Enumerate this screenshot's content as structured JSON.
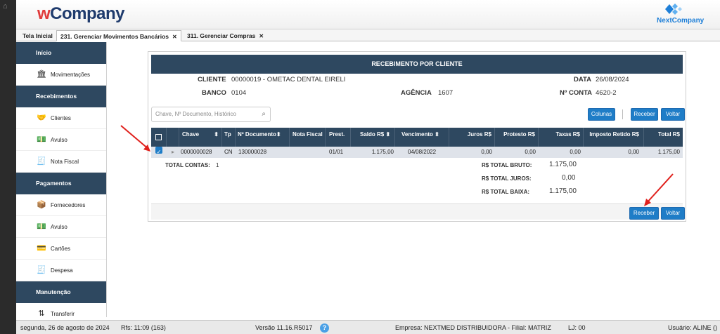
{
  "header": {
    "brand_w": "w",
    "brand_rest": "Company",
    "partner_logo_text": "NextCompany"
  },
  "tabs": [
    {
      "label": "Tela Inicial"
    },
    {
      "label": "231. Gerenciar Movimentos Bancários",
      "close": "✕"
    },
    {
      "label": "311. Gerenciar Compras",
      "close": "✕"
    }
  ],
  "sidebar": {
    "sections": [
      {
        "title": "Início",
        "items": [
          {
            "label": "Movimentações",
            "icon": "bank-icon"
          }
        ]
      },
      {
        "title": "Recebimentos",
        "items": [
          {
            "label": "Clientes",
            "icon": "handshake-icon"
          },
          {
            "label": "Avulso",
            "icon": "money-icon"
          },
          {
            "label": "Nota Fiscal",
            "icon": "invoice-icon"
          }
        ]
      },
      {
        "title": "Pagamentos",
        "items": [
          {
            "label": "Fornecedores",
            "icon": "supplier-icon"
          },
          {
            "label": "Avulso",
            "icon": "money-icon"
          },
          {
            "label": "Cartões",
            "icon": "cards-icon"
          },
          {
            "label": "Despesa",
            "icon": "expense-icon"
          }
        ]
      },
      {
        "title": "Manutenção",
        "items": [
          {
            "label": "Transferir",
            "icon": "transfer-icon"
          }
        ]
      }
    ]
  },
  "panel": {
    "title": "RECEBIMENTO POR CLIENTE",
    "cliente_label": "CLIENTE",
    "cliente_value": "00000019 - OMETAC DENTAL EIRELI",
    "data_label": "DATA",
    "data_value": "26/08/2024",
    "banco_label": "BANCO",
    "banco_value": "0104",
    "agencia_label": "AGÊNCIA",
    "agencia_value": "1607",
    "conta_label": "Nº CONTA",
    "conta_value": "4620-2",
    "search_placeholder": "Chave, Nº Documento, Histórico",
    "btn_colunas": "Colunas",
    "btn_receber": "Receber",
    "btn_voltar": "Voltar"
  },
  "table": {
    "headers": [
      "Chave",
      "Tp",
      "Nº Documento",
      "Nota Fiscal",
      "Prest.",
      "Saldo R$",
      "Vencimento",
      "Juros R$",
      "Protesto R$",
      "Taxas R$",
      "Imposto Retido R$",
      "Total R$"
    ],
    "rows": [
      {
        "checked": true,
        "chave": "0000000028",
        "tp": "CN",
        "documento": "130000028",
        "nota": "",
        "prest": "01/01",
        "saldo": "1.175,00",
        "vencimento": "04/08/2022",
        "juros": "0,00",
        "protesto": "0,00",
        "taxas": "0,00",
        "imposto": "0,00",
        "total": "1.175,00"
      }
    ]
  },
  "totals": {
    "contas_label": "TOTAL CONTAS:",
    "contas_value": "1",
    "bruto_label": "R$ TOTAL BRUTO:",
    "bruto_value": "1.175,00",
    "juros_label": "R$ TOTAL JUROS:",
    "juros_value": "0,00",
    "baixa_label": "R$ TOTAL BAIXA:",
    "baixa_value": "1.175,00"
  },
  "status": {
    "date": "segunda, 26 de agosto de 2024",
    "rfs": "Rfs: 11:09 (163)",
    "version": "Versão 11.16.R5017",
    "help": "?",
    "empresa": "Empresa: NEXTMED DISTRIBUIDORA - Filial: MATRIZ",
    "lj": "LJ: 00",
    "usuario": "Usuário: ALINE ()"
  },
  "colors": {
    "navy": "#2e4860",
    "accent": "#1f7dc7",
    "arrow": "#e0201c"
  }
}
